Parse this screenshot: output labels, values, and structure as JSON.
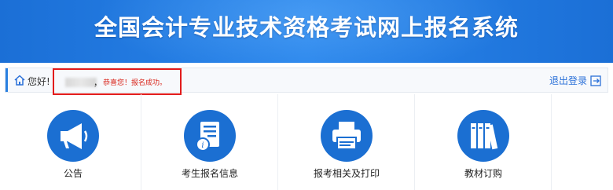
{
  "banner": {
    "title": "全国会计专业技术资格考试网上报名系统"
  },
  "userbar": {
    "greeting": "您好!",
    "comma": "，",
    "success_message": "恭喜您！报名成功。",
    "logout_label": "退出登录"
  },
  "tiles": [
    {
      "label": "公告",
      "icon": "megaphone-icon"
    },
    {
      "label": "考生报名信息",
      "icon": "info-document-icon"
    },
    {
      "label": "报考相关及打印",
      "icon": "printer-icon"
    },
    {
      "label": "教材订购",
      "icon": "books-icon"
    }
  ],
  "colors": {
    "banner": "#2a86ec",
    "tile_icon": "#1b6fd2",
    "success_text": "#d9261c",
    "highlight_box": "#e21b1b",
    "link": "#2a70d8"
  }
}
